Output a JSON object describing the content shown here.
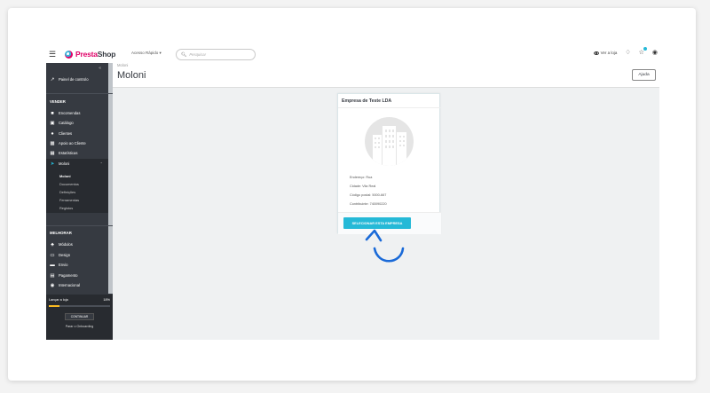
{
  "header": {
    "menu_icon": "hamburger-icon",
    "logo_text": "PrestaShop",
    "quick_access": "Acesso Rápido ▾",
    "search_placeholder": "Pesquisar",
    "view_store": "Ver a loja",
    "icons": [
      "eye-icon",
      "bell-icon",
      "trophy-icon",
      "user-icon"
    ]
  },
  "sidebar": {
    "dashboard": "Painel de controlo",
    "section_sell": "VENDER",
    "items": [
      {
        "label": "Encomendas",
        "icon": "cart-icon"
      },
      {
        "label": "Catálogo",
        "icon": "store-icon"
      },
      {
        "label": "Clientes",
        "icon": "user-icon"
      },
      {
        "label": "Apoio ao Cliente",
        "icon": "chat-icon"
      },
      {
        "label": "Estatísticas",
        "icon": "chart-icon"
      },
      {
        "label": "Moloni",
        "icon": "moloni-icon"
      }
    ],
    "moloni_sub": [
      "Moloni",
      "Documentos",
      "Definições",
      "Ferramentas",
      "Registos"
    ],
    "section_improve": "MELHORAR",
    "improve_items": [
      {
        "label": "Módulos",
        "icon": "puzzle-icon"
      },
      {
        "label": "Design",
        "icon": "monitor-icon"
      },
      {
        "label": "Envio",
        "icon": "truck-icon"
      },
      {
        "label": "Pagamento",
        "icon": "card-icon"
      },
      {
        "label": "Internacional",
        "icon": "globe-icon"
      }
    ],
    "launch_label": "Lançar a loja",
    "launch_percent": "18%",
    "launch_progress": 0.18,
    "continue_button": "CONTINUAR",
    "stop_onboarding": "Parar o Onboarding"
  },
  "page": {
    "breadcrumb": "Moloni",
    "title": "Moloni",
    "help_button": "Ajuda"
  },
  "company_card": {
    "title": "Empresa de Teste LDA",
    "address": "Endereço:  Rua",
    "city": "Cidade:  Vila Real",
    "postal": "Código postal:  5000-667",
    "taxpayer": "Contribuinte:  740090220",
    "select_button": "SELECIONAR ESTA EMPRESA"
  },
  "colors": {
    "sidebar": "#363a41",
    "accent": "#25b9d7",
    "annotation_arrow": "#1a6ad8"
  }
}
